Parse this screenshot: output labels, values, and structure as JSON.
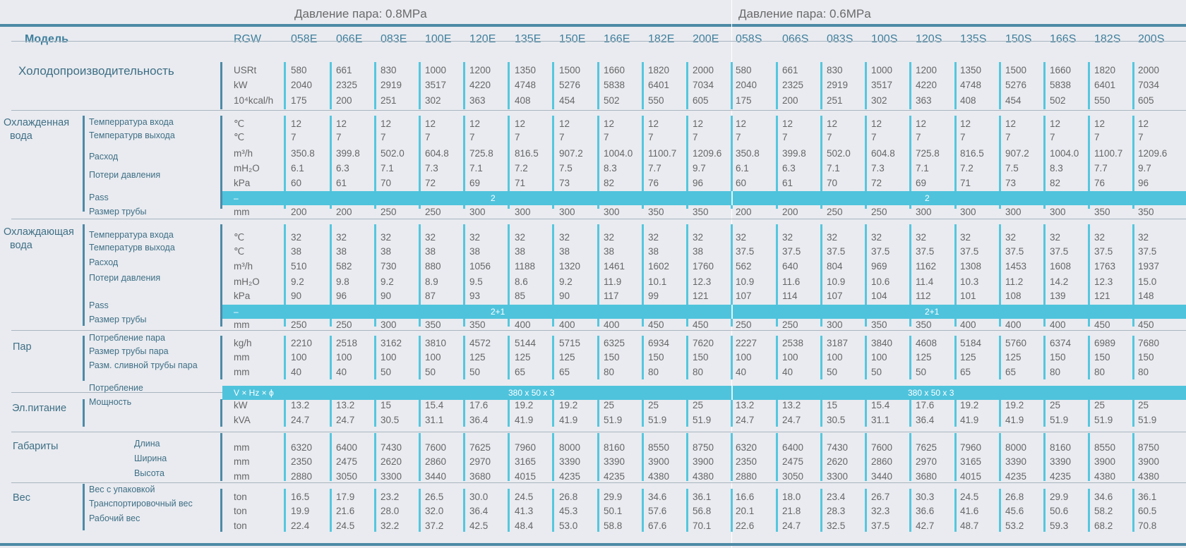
{
  "headers": {
    "left": "Давление пара: 0.8MPa",
    "right": "Давление пара: 0.6MPa"
  },
  "model_row": {
    "label": "Модель",
    "rgw": "RGW",
    "models": [
      "058E",
      "066E",
      "083E",
      "100E",
      "120E",
      "135E",
      "150E",
      "166E",
      "182E",
      "200E",
      "058S",
      "066S",
      "083S",
      "100S",
      "120S",
      "135S",
      "150S",
      "166S",
      "182S",
      "200S"
    ]
  },
  "rows": [
    {
      "cat": "Холодопроизводительность",
      "unit": "USRt",
      "values": [
        "580",
        "661",
        "830",
        "1000",
        "1200",
        "1350",
        "1500",
        "1660",
        "1820",
        "2000",
        "580",
        "661",
        "830",
        "1000",
        "1200",
        "1350",
        "1500",
        "1660",
        "1820",
        "2000"
      ]
    },
    {
      "unit": "kW",
      "values": [
        "2040",
        "2325",
        "2919",
        "3517",
        "4220",
        "4748",
        "5276",
        "5838",
        "6401",
        "7034",
        "2040",
        "2325",
        "2919",
        "3517",
        "4220",
        "4748",
        "5276",
        "5838",
        "6401",
        "7034"
      ]
    },
    {
      "unit": "10⁴kcal/h",
      "values": [
        "175",
        "200",
        "251",
        "302",
        "363",
        "408",
        "454",
        "502",
        "550",
        "605",
        "175",
        "200",
        "251",
        "302",
        "363",
        "408",
        "454",
        "502",
        "550",
        "605"
      ]
    },
    {
      "cat": "Охлажденная",
      "sub": "Темперратура входа",
      "unit": "℃",
      "values": [
        "12",
        "12",
        "12",
        "12",
        "12",
        "12",
        "12",
        "12",
        "12",
        "12",
        "12",
        "12",
        "12",
        "12",
        "12",
        "12",
        "12",
        "12",
        "12",
        "12"
      ]
    },
    {
      "cat": "вода",
      "sub": "Темперaтурв выхода",
      "unit": "℃",
      "values": [
        "7",
        "7",
        "7",
        "7",
        "7",
        "7",
        "7",
        "7",
        "7",
        "7",
        "7",
        "7",
        "7",
        "7",
        "7",
        "7",
        "7",
        "7",
        "7",
        "7"
      ]
    },
    {
      "sub": "Расход",
      "unit": "m³/h",
      "values": [
        "350.8",
        "399.8",
        "502.0",
        "604.8",
        "725.8",
        "816.5",
        "907.2",
        "1004.0",
        "1100.7",
        "1209.6",
        "350.8",
        "399.8",
        "502.0",
        "604.8",
        "725.8",
        "816.5",
        "907.2",
        "1004.0",
        "1100.7",
        "1209.6"
      ]
    },
    {
      "unit": "mH₂O",
      "values": [
        "6.1",
        "6.3",
        "7.1",
        "7.3",
        "7.1",
        "7.2",
        "7.5",
        "8.3",
        "7.7",
        "9.7",
        "6.1",
        "6.3",
        "7.1",
        "7.3",
        "7.1",
        "7.2",
        "7.5",
        "8.3",
        "7.7",
        "9.7"
      ]
    },
    {
      "sub": "Потери давления",
      "unit": "kPa",
      "values": [
        "60",
        "61",
        "70",
        "72",
        "69",
        "71",
        "73",
        "82",
        "76",
        "96",
        "60",
        "61",
        "70",
        "72",
        "69",
        "71",
        "73",
        "82",
        "76",
        "96"
      ]
    },
    {
      "sub": "Pass",
      "band": true,
      "unit": "–",
      "left": "2",
      "right": "2"
    },
    {
      "sub": "Размер трубы",
      "unit": "mm",
      "values": [
        "200",
        "200",
        "250",
        "250",
        "300",
        "300",
        "300",
        "300",
        "350",
        "350",
        "200",
        "200",
        "250",
        "250",
        "300",
        "300",
        "300",
        "300",
        "350",
        "350"
      ]
    },
    {
      "cat": "Охлаждающая",
      "sub": "Темперратура входа",
      "unit": "℃",
      "values": [
        "32",
        "32",
        "32",
        "32",
        "32",
        "32",
        "32",
        "32",
        "32",
        "32",
        "32",
        "32",
        "32",
        "32",
        "32",
        "32",
        "32",
        "32",
        "32",
        "32"
      ]
    },
    {
      "cat": "вода",
      "sub": "Темперaтурв выхода",
      "unit": "℃",
      "values": [
        "38",
        "38",
        "38",
        "38",
        "38",
        "38",
        "38",
        "38",
        "38",
        "38",
        "37.5",
        "37.5",
        "37.5",
        "37.5",
        "37.5",
        "37.5",
        "37.5",
        "37.5",
        "37.5",
        "37.5"
      ]
    },
    {
      "sub": "Расход",
      "unit": "m³/h",
      "values": [
        "510",
        "582",
        "730",
        "880",
        "1056",
        "1188",
        "1320",
        "1461",
        "1602",
        "1760",
        "562",
        "640",
        "804",
        "969",
        "1162",
        "1308",
        "1453",
        "1608",
        "1763",
        "1937"
      ]
    },
    {
      "sub": "Потери давления",
      "unit": "mH₂O",
      "values": [
        "9.2",
        "9.8",
        "9.2",
        "8.9",
        "9.5",
        "8.6",
        "9.2",
        "11.9",
        "10.1",
        "12.3",
        "10.9",
        "11.6",
        "10.9",
        "10.6",
        "11.4",
        "10.3",
        "11.2",
        "14.2",
        "12.3",
        "15.0"
      ]
    },
    {
      "unit": "kPa",
      "values": [
        "90",
        "96",
        "90",
        "87",
        "93",
        "85",
        "90",
        "117",
        "99",
        "121",
        "107",
        "114",
        "107",
        "104",
        "112",
        "101",
        "108",
        "139",
        "121",
        "148"
      ]
    },
    {
      "sub": "Pass",
      "band": true,
      "unit": "–",
      "left": "2+1",
      "right": "2+1"
    },
    {
      "sub": "Размер трубы",
      "unit": "mm",
      "values": [
        "250",
        "250",
        "300",
        "350",
        "350",
        "400",
        "400",
        "400",
        "450",
        "450",
        "250",
        "250",
        "300",
        "350",
        "350",
        "400",
        "400",
        "400",
        "450",
        "450"
      ]
    },
    {
      "cat": "Пар",
      "sub": "Потребление пара",
      "unit": "kg/h",
      "values": [
        "2210",
        "2518",
        "3162",
        "3810",
        "4572",
        "5144",
        "5715",
        "6325",
        "6934",
        "7620",
        "2227",
        "2538",
        "3187",
        "3840",
        "4608",
        "5184",
        "5760",
        "6374",
        "6989",
        "7680"
      ]
    },
    {
      "sub": "Размер трубы пара",
      "unit": "mm",
      "values": [
        "100",
        "100",
        "100",
        "100",
        "125",
        "125",
        "125",
        "150",
        "150",
        "150",
        "100",
        "100",
        "100",
        "100",
        "125",
        "125",
        "125",
        "150",
        "150",
        "150"
      ]
    },
    {
      "sub": "Разм. сливной трубы пара",
      "unit": "mm",
      "values": [
        "40",
        "40",
        "50",
        "50",
        "50",
        "65",
        "65",
        "80",
        "80",
        "80",
        "40",
        "40",
        "50",
        "50",
        "50",
        "65",
        "65",
        "80",
        "80",
        "80"
      ]
    },
    {
      "band": true,
      "unit": "V × Hz × ϕ",
      "left": "380 x 50 x 3",
      "right": "380 x 50 x 3"
    },
    {
      "cat": "Эл.питание",
      "sub": "Потребление",
      "unit": "kW",
      "values": [
        "13.2",
        "13.2",
        "15",
        "15.4",
        "17.6",
        "19.2",
        "19.2",
        "25",
        "25",
        "25",
        "13.2",
        "13.2",
        "15",
        "15.4",
        "17.6",
        "19.2",
        "19.2",
        "25",
        "25",
        "25"
      ]
    },
    {
      "sub": "Мощность",
      "unit": "kVA",
      "values": [
        "24.7",
        "24.7",
        "30.5",
        "31.1",
        "36.4",
        "41.9",
        "41.9",
        "51.9",
        "51.9",
        "51.9",
        "24.7",
        "24.7",
        "30.5",
        "31.1",
        "36.4",
        "41.9",
        "41.9",
        "51.9",
        "51.9",
        "51.9"
      ]
    },
    {
      "cat": "Габариты",
      "sub": "Длина",
      "unit": "mm",
      "values": [
        "6320",
        "6400",
        "7430",
        "7600",
        "7625",
        "7960",
        "8000",
        "8160",
        "8550",
        "8750",
        "6320",
        "6400",
        "7430",
        "7600",
        "7625",
        "7960",
        "8000",
        "8160",
        "8550",
        "8750"
      ]
    },
    {
      "sub": "Ширина",
      "unit": "mm",
      "values": [
        "2350",
        "2475",
        "2620",
        "2860",
        "2970",
        "3165",
        "3390",
        "3390",
        "3900",
        "3900",
        "2350",
        "2475",
        "2620",
        "2860",
        "2970",
        "3165",
        "3390",
        "3390",
        "3900",
        "3900"
      ]
    },
    {
      "sub": "Высота",
      "unit": "mm",
      "values": [
        "2880",
        "3050",
        "3300",
        "3440",
        "3680",
        "4015",
        "4235",
        "4235",
        "4380",
        "4380",
        "2880",
        "3050",
        "3300",
        "3440",
        "3680",
        "4015",
        "4235",
        "4235",
        "4380",
        "4380"
      ]
    },
    {
      "cat": "Вес",
      "sub": "Вес с упаковкой",
      "unit": "ton",
      "values": [
        "16.5",
        "17.9",
        "23.2",
        "26.5",
        "30.0",
        "24.5",
        "26.8",
        "29.9",
        "34.6",
        "36.1",
        "16.6",
        "18.0",
        "23.4",
        "26.7",
        "30.3",
        "24.5",
        "26.8",
        "29.9",
        "34.6",
        "36.1"
      ]
    },
    {
      "sub": "Транспортировочный вес",
      "unit": "ton",
      "values": [
        "19.9",
        "21.6",
        "28.0",
        "32.0",
        "36.4",
        "41.3",
        "45.3",
        "50.1",
        "57.6",
        "56.8",
        "20.1",
        "21.8",
        "28.3",
        "32.3",
        "36.6",
        "41.6",
        "45.6",
        "50.6",
        "58.2",
        "60.5"
      ]
    },
    {
      "sub": "Рабочий вес",
      "unit": "ton",
      "values": [
        "22.4",
        "24.5",
        "32.2",
        "37.2",
        "42.5",
        "48.4",
        "53.0",
        "58.8",
        "67.6",
        "70.1",
        "22.6",
        "24.7",
        "32.5",
        "37.5",
        "42.7",
        "48.7",
        "53.2",
        "59.3",
        "68.2",
        "70.8"
      ]
    }
  ]
}
